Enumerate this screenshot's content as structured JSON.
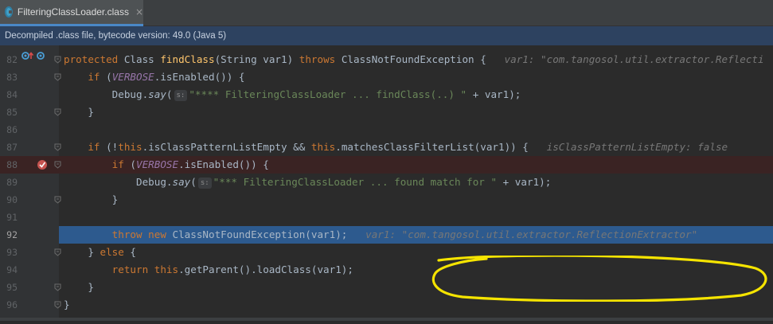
{
  "tab": {
    "label": "FilteringClassLoader.class",
    "close": "×"
  },
  "notice": "Decompiled .class file, bytecode version: 49.0 (Java 5)",
  "colors": {
    "keyword": "#cc7832",
    "function": "#ffc66d",
    "string": "#6a8759",
    "constant": "#9876aa",
    "exec_line": "#2d5a8e",
    "breakpoint_line": "#3a2323",
    "annotation": "#f5e400"
  },
  "lines": [
    {
      "num": "82",
      "t": [
        {
          "c": "kw",
          "v": "protected"
        },
        {
          "v": " Class "
        },
        {
          "c": "fn",
          "v": "findClass"
        },
        {
          "v": "(String var1) "
        },
        {
          "c": "kw",
          "v": "throws"
        },
        {
          "v": " ClassNotFoundException {   "
        },
        {
          "c": "hint",
          "v": "var1: \"com.tangosol.util.extractor.Reflecti"
        }
      ]
    },
    {
      "num": "83",
      "t": [
        {
          "v": "    "
        },
        {
          "c": "kw",
          "v": "if"
        },
        {
          "v": " ("
        },
        {
          "c": "it",
          "v": "VERBOSE"
        },
        {
          "v": ".isEnabled()) {"
        }
      ]
    },
    {
      "num": "84",
      "t": [
        {
          "v": "        Debug."
        },
        {
          "c": "mi",
          "v": "say"
        },
        {
          "v": "("
        },
        {
          "c": "pbox",
          "v": "s:"
        },
        {
          "c": "st",
          "v": "\"**** FilteringClassLoader ... findClass(..) \""
        },
        {
          "v": " + var1);"
        }
      ]
    },
    {
      "num": "85",
      "t": [
        {
          "v": "    }"
        }
      ]
    },
    {
      "num": "86",
      "t": []
    },
    {
      "num": "87",
      "t": [
        {
          "v": "    "
        },
        {
          "c": "kw",
          "v": "if"
        },
        {
          "v": " (!"
        },
        {
          "c": "kw",
          "v": "this"
        },
        {
          "v": ".isClassPatternListEmpty && "
        },
        {
          "c": "kw",
          "v": "this"
        },
        {
          "v": ".matchesClassFilterList(var1)) {   "
        },
        {
          "c": "hint",
          "v": "isClassPatternListEmpty: false"
        }
      ]
    },
    {
      "num": "88",
      "t": [
        {
          "v": "        "
        },
        {
          "c": "kw",
          "v": "if"
        },
        {
          "v": " ("
        },
        {
          "c": "it",
          "v": "VERBOSE"
        },
        {
          "v": ".isEnabled()) {"
        }
      ]
    },
    {
      "num": "89",
      "t": [
        {
          "v": "            Debug."
        },
        {
          "c": "mi",
          "v": "say"
        },
        {
          "v": "("
        },
        {
          "c": "pbox",
          "v": "s:"
        },
        {
          "c": "st",
          "v": "\"*** FilteringClassLoader ... found match for \""
        },
        {
          "v": " + var1);"
        }
      ]
    },
    {
      "num": "90",
      "t": [
        {
          "v": "        }"
        }
      ]
    },
    {
      "num": "91",
      "t": []
    },
    {
      "num": "92",
      "t": [
        {
          "v": "        "
        },
        {
          "c": "kw",
          "v": "throw new"
        },
        {
          "v": " ClassNotFoundException(var1);   "
        },
        {
          "c": "hint",
          "v": "var1: \"com.tangosol.util.extractor.ReflectionExtractor\""
        }
      ]
    },
    {
      "num": "93",
      "t": [
        {
          "v": "    } "
        },
        {
          "c": "kw",
          "v": "else"
        },
        {
          "v": " {"
        }
      ]
    },
    {
      "num": "94",
      "t": [
        {
          "v": "        "
        },
        {
          "c": "kw",
          "v": "return this"
        },
        {
          "v": ".getParent().loadClass(var1);"
        }
      ]
    },
    {
      "num": "95",
      "t": [
        {
          "v": "    }"
        }
      ]
    },
    {
      "num": "96",
      "t": [
        {
          "v": "}"
        }
      ]
    }
  ]
}
